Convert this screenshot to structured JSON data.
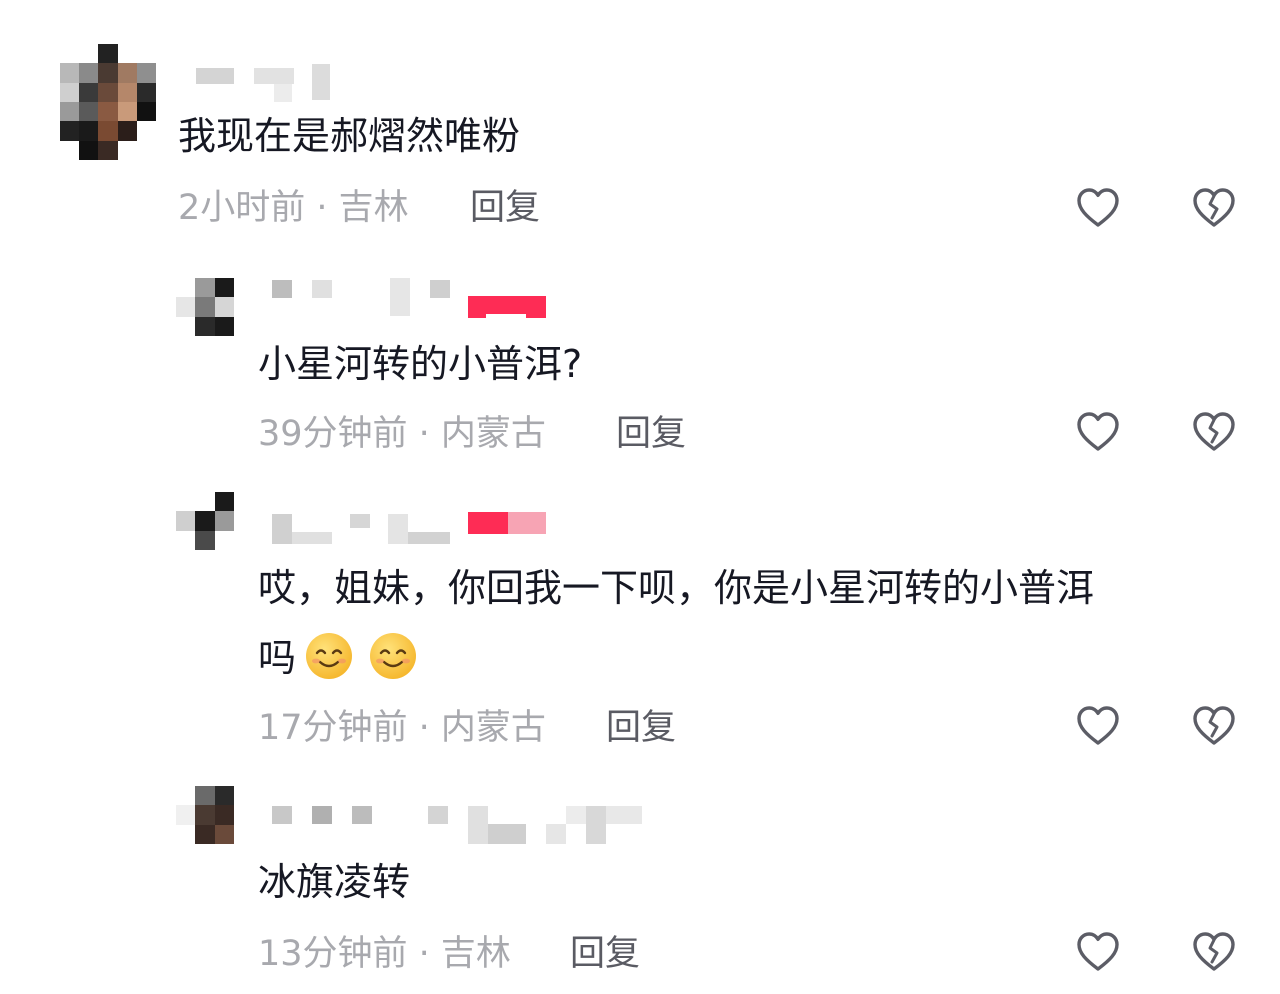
{
  "comments": [
    {
      "text": "我现在是郝熠然唯粉",
      "meta": "2小时前 · 吉林",
      "reply_label": "回复",
      "like_icon": "heart-outline-icon",
      "dislike_icon": "broken-heart-icon"
    },
    {
      "text": "小星河转的小普洱?",
      "meta": "39分钟前 · 内蒙古",
      "reply_label": "回复",
      "like_icon": "heart-outline-icon",
      "dislike_icon": "broken-heart-icon"
    },
    {
      "text_line1": "哎，姐妹，你回我一下呗，你是小星河转的小普洱",
      "text_line2": "吗",
      "emojis": [
        "smiling-face-emoji",
        "smiling-face-emoji"
      ],
      "meta": "17分钟前 · 内蒙古",
      "reply_label": "回复",
      "like_icon": "heart-outline-icon",
      "dislike_icon": "broken-heart-icon"
    },
    {
      "text": "冰旗凌转",
      "meta": "13分钟前 · 吉林",
      "reply_label": "回复",
      "like_icon": "heart-outline-icon",
      "dislike_icon": "broken-heart-icon"
    }
  ],
  "colors": {
    "text": "#161823",
    "meta": "#a8a9ae",
    "reply": "#5a5b63",
    "icon": "#5c5d66",
    "badge": "#fe2c55"
  }
}
